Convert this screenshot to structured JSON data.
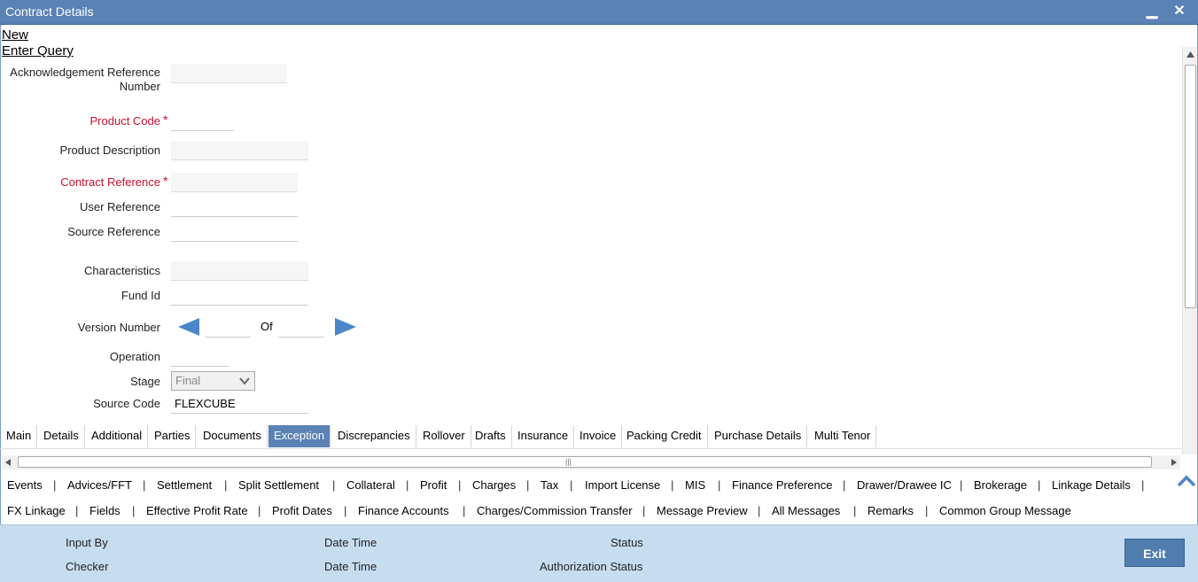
{
  "window": {
    "title": "Contract Details",
    "minimize": "▁",
    "close": "✕"
  },
  "toolbar": {
    "new": "New",
    "enter_query": "Enter Query"
  },
  "form": {
    "ack_ref_label": "Acknowledgement Reference Number",
    "product_code_label": "Product Code",
    "product_desc_label": "Product Description",
    "contract_ref_label": "Contract Reference",
    "user_ref_label": "User Reference",
    "source_ref_label": "Source Reference",
    "characteristics_label": "Characteristics",
    "fund_id_label": "Fund Id",
    "version_label": "Version Number",
    "of_label": "Of",
    "operation_label": "Operation",
    "stage_label": "Stage",
    "stage_value": "Final",
    "source_code_label": "Source Code",
    "source_code_value": "FLEXCUBE",
    "required_mark": "*"
  },
  "tabs": [
    {
      "label": "Main"
    },
    {
      "label": "Details"
    },
    {
      "label": "Additional"
    },
    {
      "label": "Parties"
    },
    {
      "label": "Documents"
    },
    {
      "label": "Exception"
    },
    {
      "label": "Discrepancies"
    },
    {
      "label": "Rollover"
    },
    {
      "label": "Drafts"
    },
    {
      "label": "Insurance"
    },
    {
      "label": "Invoice"
    },
    {
      "label": "Packing Credit"
    },
    {
      "label": "Purchase Details"
    },
    {
      "label": "Multi Tenor"
    }
  ],
  "active_tab": "Exception",
  "links_row1": [
    "Events",
    "Advices/FFT",
    "Settlement",
    "Split Settlement",
    "Collateral",
    "Profit",
    "Charges",
    "Tax",
    "Import License",
    "MIS",
    "Finance Preference",
    "Drawer/Drawee IC",
    "Brokerage",
    "Linkage Details"
  ],
  "links_row2": [
    "FX Linkage",
    "Fields",
    "Effective Profit Rate",
    "Profit Dates",
    "Finance Accounts",
    "Charges/Commission Transfer",
    "Message Preview",
    "All Messages",
    "Remarks",
    "Common Group Message"
  ],
  "separator": "|",
  "footer": {
    "input_by": "Input By",
    "checker": "Checker",
    "date_time_1": "Date Time",
    "date_time_2": "Date Time",
    "status": "Status",
    "auth_status": "Authorization Status",
    "exit": "Exit"
  },
  "colors": {
    "title_bar": "#5a82b5",
    "required": "#c8102e",
    "footer": "#c6ddf0"
  }
}
